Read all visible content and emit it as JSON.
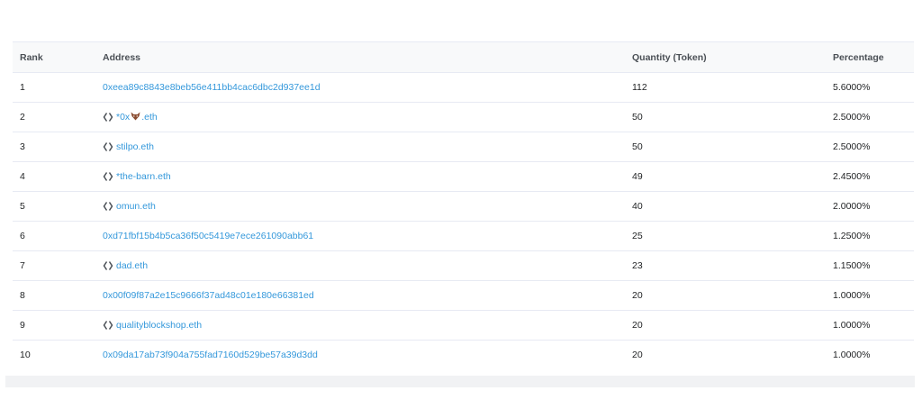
{
  "table": {
    "headers": {
      "rank": "Rank",
      "address": "Address",
      "quantity": "Quantity (Token)",
      "percentage": "Percentage"
    },
    "rows": [
      {
        "rank": "1",
        "address": "0xeea89c8843e8beb56e411bb4cac6dbc2d937ee1d",
        "quantity": "112",
        "percentage": "5.6000%"
      },
      {
        "rank": "2",
        "address_prefix": "*0x",
        "address_icon": "fox-emoji-icon",
        "address_suffix": ".eth",
        "quantity": "50",
        "percentage": "2.5000%"
      },
      {
        "rank": "3",
        "address": "stilpo.eth",
        "quantity": "50",
        "percentage": "2.5000%"
      },
      {
        "rank": "4",
        "address": "*the-barn.eth",
        "quantity": "49",
        "percentage": "2.4500%"
      },
      {
        "rank": "5",
        "address": "omun.eth",
        "quantity": "40",
        "percentage": "2.0000%"
      },
      {
        "rank": "6",
        "address": "0xd71fbf15b4b5ca36f50c5419e7ece261090abb61",
        "quantity": "25",
        "percentage": "1.2500%"
      },
      {
        "rank": "7",
        "address": "dad.eth",
        "quantity": "23",
        "percentage": "1.1500%"
      },
      {
        "rank": "8",
        "address": "0x00f09f87a2e15c9666f37ad48c01e180e66381ed",
        "quantity": "20",
        "percentage": "1.0000%"
      },
      {
        "rank": "9",
        "address": "qualityblockshop.eth",
        "quantity": "20",
        "percentage": "1.0000%"
      },
      {
        "rank": "10",
        "address": "0x09da17ab73f904a755fad7160d529be57a39d3dd",
        "quantity": "20",
        "percentage": "1.0000%"
      }
    ],
    "link_color": "#3498db",
    "ens_icon": "ens-bracket-icon"
  }
}
